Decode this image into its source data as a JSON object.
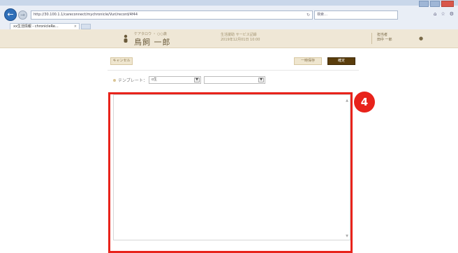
{
  "browser": {
    "address_url": "http://30.100.1.1/careconnect/mychronicle/Vuri/record/4f44",
    "search_text": "検索…",
    "tab_title": "xx生活情報 - chronicleRe...",
    "nav_icons": [
      "back-icon",
      "forward-icon"
    ],
    "tool_icons": [
      "home-icon",
      "star-icon",
      "gear-icon"
    ]
  },
  "header": {
    "user_kana": "ケアタロウ ・ ○○歳",
    "user_name": "鳥飼 一郎",
    "center_line1": "生活援助 サービス記録",
    "center_line2": "2019年12月01日 10:00",
    "staff_label": "担当者",
    "staff_name": "田中 一郎"
  },
  "actions": {
    "cancel_label": "キャンセル",
    "temp_save_label": "一時保存",
    "confirm_label": "確定"
  },
  "template": {
    "label": "テンプレート：",
    "select1_value": "o生",
    "select2_value": ""
  },
  "annotation": {
    "step_number": "4",
    "color": "#e8231b"
  }
}
